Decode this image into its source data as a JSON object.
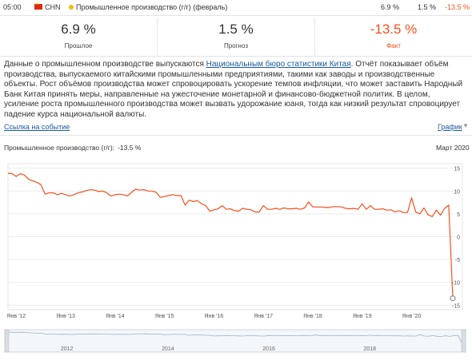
{
  "topbar": {
    "time": "05:00",
    "country": "CHN",
    "event": "Промышленное производство (г/г) (февраль)",
    "actual": "6.9 %",
    "forecast": "1.5 %",
    "previous": "-13.5 %"
  },
  "stats": {
    "previous": {
      "value": "6.9 %",
      "label": "Прошлое"
    },
    "forecast": {
      "value": "1.5 %",
      "label": "Прогноз"
    },
    "fact": {
      "value": "-13.5 %",
      "label": "Факт"
    }
  },
  "description": {
    "before": "Данные о промышленном производстве выпускаются ",
    "link": "Национальным бюро статистики Китая",
    "after": ". Отчёт показывает объём производства, выпускаемого китайскими промышленными предприятиями, такими как заводы и производственные объекты. Рост объёмов производства может спровоцировать ускорение темпов инфляции, что может заставить Народный Банк Китая принять меры, направленные на ужесточение монетарной и финансово-бюджетной политик. В целом, усиление роста промышленного производства может вызвать удорожание юаня, тогда как низкий результат спровоцирует падение курса национальной валюты."
  },
  "links": {
    "event": "Ссылка на событие",
    "chart": "График"
  },
  "chart_header": {
    "title": "Промышленное производство (г/г):",
    "value": "-13.5 %",
    "date": "Март 2020"
  },
  "colors": {
    "accent": "#f5501e",
    "link": "#1a5aa0"
  },
  "chart_data": {
    "type": "line",
    "title": "Промышленное производство (г/г):",
    "x_ticks": [
      "Янв '12",
      "Янв '13",
      "Янв '14",
      "Янв '15",
      "Янв '16",
      "Янв '17",
      "Янв '18",
      "Янв '19",
      "Янв '20"
    ],
    "y_ticks": [
      15,
      10,
      5,
      0,
      -5,
      -10,
      -15
    ],
    "ylim": [
      -16,
      16
    ],
    "x_start": "2011-11",
    "series": [
      {
        "values": [
          13.9,
          13.8,
          13.2,
          13.8,
          13.5,
          12.6,
          12.2,
          11.9,
          11.4,
          9.3,
          9.6,
          9.6,
          9.2,
          9.5,
          9.2,
          8.9,
          9.2,
          9.6,
          9.8,
          10.1,
          10.3,
          10.2,
          9.9,
          10.0,
          9.6,
          8.9,
          9.2,
          9.3,
          9.2,
          8.9,
          9.7,
          10.4,
          10.2,
          10.3,
          10.0,
          10.0,
          9.7,
          8.6,
          8.8,
          9.0,
          9.2,
          9.0,
          9.0,
          6.9,
          8.0,
          7.7,
          7.9,
          7.2,
          6.8,
          5.6,
          5.9,
          6.1,
          6.8,
          6.0,
          6.1,
          5.7,
          5.6,
          6.2,
          6.0,
          5.9,
          5.4,
          5.4,
          6.8,
          6.0,
          6.0,
          6.2,
          6.0,
          6.3,
          6.1,
          6.1,
          6.2,
          6.0,
          6.3,
          7.6,
          6.5,
          6.5,
          6.5,
          6.4,
          6.4,
          6.6,
          6.6,
          6.5,
          6.2,
          6.1,
          6.2,
          6.0,
          7.2,
          6.0,
          6.8,
          6.0,
          6.0,
          6.1,
          5.8,
          5.9,
          5.4,
          5.7,
          5.3,
          5.3,
          8.5,
          5.4,
          5.0,
          6.3,
          4.8,
          4.4,
          5.8,
          4.7,
          6.2,
          6.9,
          -13.5
        ]
      }
    ]
  },
  "navigator": {
    "years": [
      "2012",
      "2014",
      "2016",
      "2018"
    ]
  }
}
